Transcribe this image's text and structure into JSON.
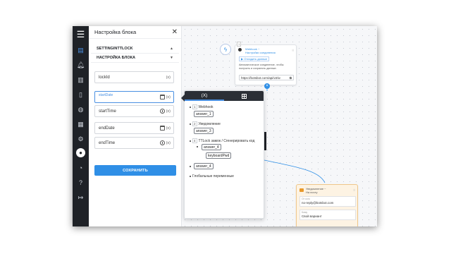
{
  "rail": {
    "icons": [
      "menu-icon",
      "document-icon",
      "bell-icon",
      "bar-chart-icon",
      "file-icon",
      "chat-icon",
      "table-icon",
      "gears-icon",
      "user-icon",
      "dashboard-icon",
      "help-icon",
      "logout-icon"
    ]
  },
  "panel": {
    "title": "Настройка блока",
    "section1": "SETTINGINTTLOCK",
    "section2": "НАСТРОЙКА БЛОКА",
    "fields": [
      {
        "value": "lockId",
        "placeholder": "",
        "var": "(x)"
      },
      {
        "value": "",
        "placeholder": "startDate",
        "var": "(x)"
      },
      {
        "value": "startTime",
        "placeholder": "",
        "var": "(x)"
      },
      {
        "value": "endDate",
        "placeholder": "",
        "var": "(x)"
      },
      {
        "value": "endTime",
        "placeholder": "",
        "var": "(x)"
      }
    ],
    "save_label": "СОХРАНИТЬ"
  },
  "webhook_card": {
    "num": "1",
    "title": "Webhook ~",
    "subtitle": "Настройки соединения",
    "button": "Отладить данные",
    "desc": "Автоматическое соединение, чтобы получать и сохранять данные.",
    "url": "https://botsbot.com/api/v2/w"
  },
  "vars": {
    "tab_x": "(X)",
    "items": [
      {
        "num": "1",
        "label": "Webhook"
      },
      {
        "chip": "answer_1"
      },
      {
        "num": "2",
        "label": "Уведомление"
      },
      {
        "chip": "answer_3"
      },
      {
        "num": "4",
        "label": "TTLock замок / Сгенерировать код"
      },
      {
        "chip": "answer_4"
      },
      {
        "chip": "keyboardPwd"
      },
      {
        "chip": "answer_4"
      },
      {
        "label": "Глобальные переменные"
      }
    ]
  },
  "notif_card": {
    "title": "Уведомление ~",
    "subtitle": "На почту",
    "from_label": "От кого",
    "from_value": "no-reply@botsbot.com",
    "option_label": "Кому",
    "option_value": "Свой вариант"
  },
  "colors": {
    "accent": "#2f8fe6",
    "rail": "#1f2227"
  }
}
